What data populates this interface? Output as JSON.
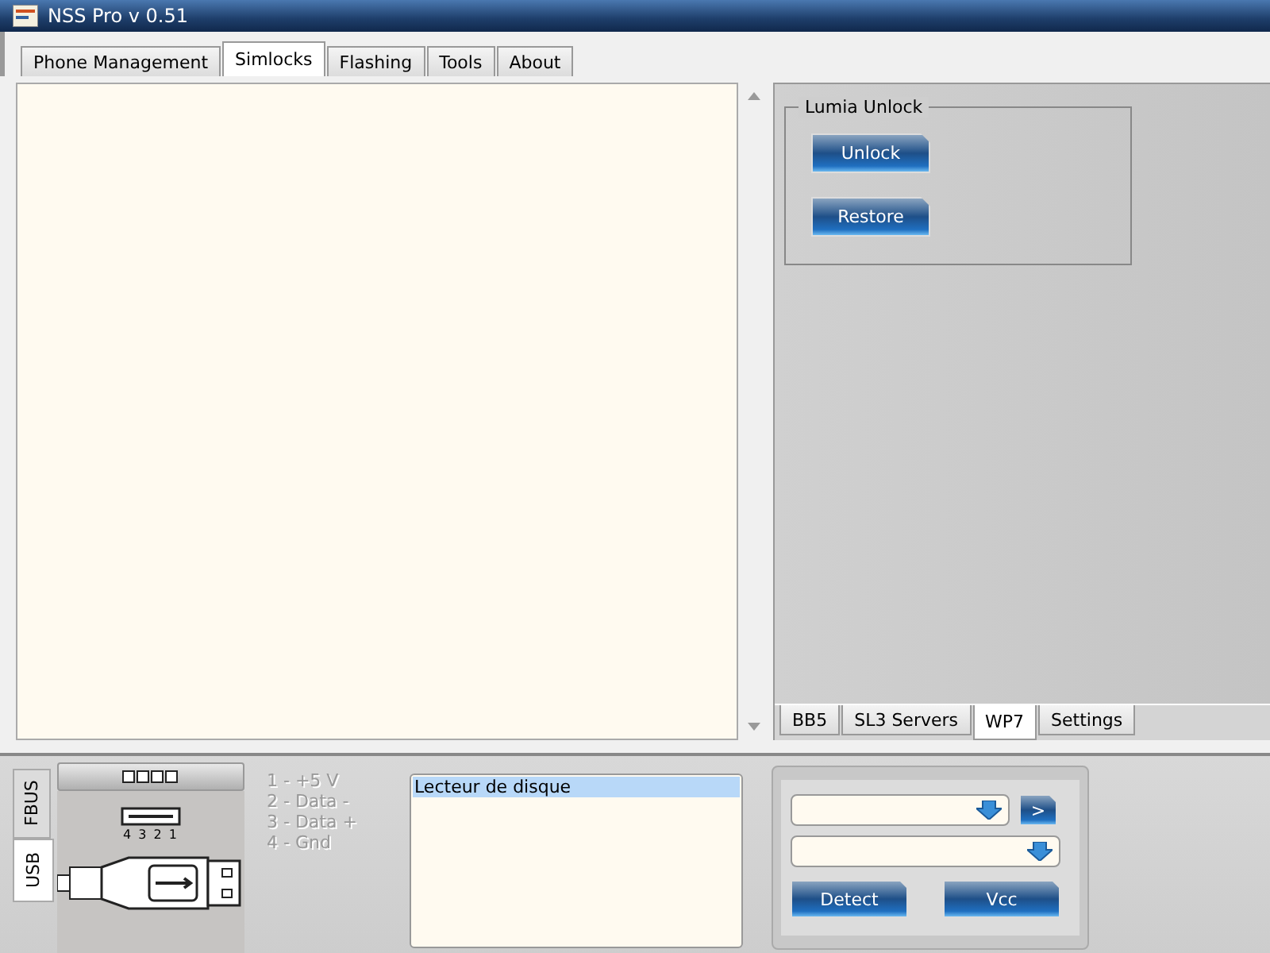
{
  "window": {
    "title": "NSS Pro v 0.51"
  },
  "tabs": [
    {
      "label": "Phone Management",
      "selected": false
    },
    {
      "label": "Simlocks",
      "selected": true
    },
    {
      "label": "Flashing",
      "selected": false
    },
    {
      "label": "Tools",
      "selected": false
    },
    {
      "label": "About",
      "selected": false
    }
  ],
  "right_panel": {
    "group": {
      "title": "Lumia Unlock",
      "buttons": [
        "Unlock",
        "Restore"
      ]
    },
    "tabs": [
      {
        "label": "BB5",
        "selected": false
      },
      {
        "label": "SL3 Servers",
        "selected": false
      },
      {
        "label": "WP7",
        "selected": true
      },
      {
        "label": "Settings",
        "selected": false
      }
    ]
  },
  "connection": {
    "tabs": [
      {
        "label": "FBUS",
        "selected": false
      },
      {
        "label": "USB",
        "selected": true
      }
    ],
    "pin_numbers": "4 3 2 1",
    "pinout": [
      "1 - +5 V",
      "2 - Data -",
      "3 - Data +",
      "4 - Gnd"
    ],
    "devices": [
      {
        "label": "Lecteur de disque",
        "selected": true
      }
    ]
  },
  "controls": {
    "go_button": ">",
    "buttons": [
      "Detect",
      "Vcc"
    ]
  }
}
